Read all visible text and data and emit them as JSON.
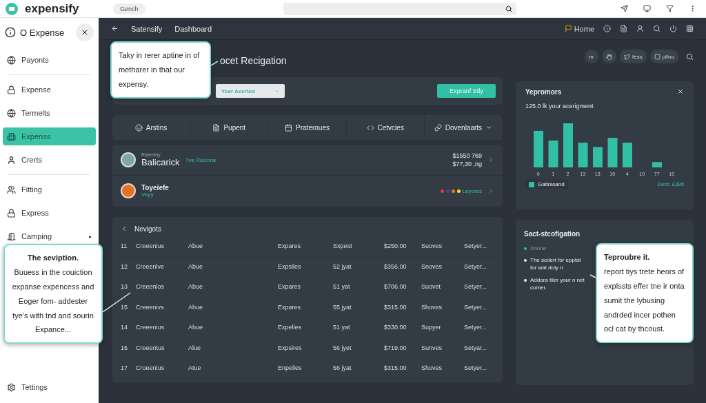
{
  "topbar": {
    "brand": "expensify",
    "chip": "Gench"
  },
  "sidebar": {
    "header": "O Expense",
    "items": [
      {
        "label": "Payonts",
        "selected": false,
        "divider_after": true
      },
      {
        "label": "Expense",
        "selected": false,
        "divider_after": false
      },
      {
        "label": "Termelts",
        "selected": false,
        "divider_after": false
      },
      {
        "label": "Expenss",
        "selected": true,
        "divider_after": false
      },
      {
        "label": "Crerts",
        "selected": false,
        "divider_after": true
      },
      {
        "label": "Fitting",
        "selected": false,
        "divider_after": false
      },
      {
        "label": "Express",
        "selected": false,
        "divider_after": false
      },
      {
        "label": "Camping",
        "selected": false,
        "divider_after": false,
        "caret": "▸"
      }
    ],
    "footer": "Tettings"
  },
  "nav": {
    "crumbs": [
      "Satensify",
      "Dashboard"
    ],
    "home": "Home"
  },
  "page_title": "ocet Recigation",
  "pills": [
    {
      "kind": "text",
      "label": "m"
    },
    {
      "kind": "hand"
    },
    {
      "kind": "bird",
      "label": "fess"
    },
    {
      "kind": "square",
      "label": "pifno"
    }
  ],
  "filter": {
    "dropdown": "Yoer Acerted",
    "button": "Expranf Stly"
  },
  "tabs": [
    {
      "label": "Arstins",
      "caret": false
    },
    {
      "label": "Pupent",
      "caret": false
    },
    {
      "label": "Praterouеs",
      "caret": false
    },
    {
      "label": "Cetvcies",
      "caret": false
    },
    {
      "label": "Dovenlaarts",
      "caret": true
    }
  ],
  "people": [
    {
      "kind": "amount",
      "caption": "Ratenihy",
      "name": "Balicarick",
      "tag": "Tve Relcone",
      "amounts": [
        "$1550 769",
        "$77,30 ,ng"
      ]
    },
    {
      "kind": "dots",
      "name": "Toyeiefe",
      "tag": "Vepy",
      "dots": [
        {
          "color": "#e53935"
        },
        {
          "color": "#3949ab"
        },
        {
          "color": "#f57c00"
        },
        {
          "color": "#fdd835"
        }
      ],
      "dots_label": "Leyores"
    }
  ],
  "table": {
    "title": "Nevigots",
    "rows": [
      [
        "11",
        "Creeenius",
        "Abue",
        "Expares",
        "Sxpest",
        "$250.00",
        "Suoves",
        "Setyer..."
      ],
      [
        "12",
        "Creeenlve",
        "Abue",
        "Expsiles",
        "52 jyat",
        "$356.00",
        "Snoves",
        "Setyer..."
      ],
      [
        "13",
        "Creeenlos",
        "Abue",
        "Expares",
        "51 yat",
        "$706.00",
        "Suovet",
        "Setyer..."
      ],
      [
        "15",
        "Creeenivs",
        "Ahue",
        "Expares",
        "55 jyat",
        "$315.00",
        "Shoves",
        "Setyer..."
      ],
      [
        "14",
        "Creeenius",
        "Ahue",
        "Expelles",
        "51 yat",
        "$330.00",
        "Supyer",
        "Setyer..."
      ],
      [
        "15",
        "Creeentus",
        "Alue",
        "Expsires",
        "56 jyet",
        "$719.00",
        "Sunves",
        "Setyar..."
      ],
      [
        "17",
        "Croeenius",
        "Atue",
        "Enpeiles",
        "56 jyat",
        "$315.00",
        "Shoves",
        "Setyer..."
      ]
    ]
  },
  "chart_card": {
    "title": "Yepromors",
    "subtitle": "125.0 lk your acerigment",
    "x_labels": [
      "0",
      "1",
      "2",
      "13",
      "13",
      "10",
      "4",
      "10",
      "77",
      "10"
    ],
    "legend": "Gatinloand",
    "total": "Debt: £38fi"
  },
  "notes": {
    "title": "Sact-stcofigation",
    "items": [
      {
        "text": "Xnnne",
        "accent": true
      },
      {
        "text": "The scdert for epplat for wat doly n",
        "accent": false
      },
      {
        "text": "Addora tiler your n net comer.",
        "accent": false
      }
    ]
  },
  "callouts": [
    {
      "text": "Taky in rerer aptine in of metharer in that our expensy."
    },
    {
      "title": "The seviption.",
      "text": "Buuess in the couiction expanse expencess and Eoger fom- addester tye's with tnd and sourin Expance..."
    },
    {
      "title": "Teproubre it.",
      "text": "report tiys trete heors of explssts effer tne ir onta sumit the lybusing andrded incer pothen ocl cat by thcoust."
    }
  ]
}
